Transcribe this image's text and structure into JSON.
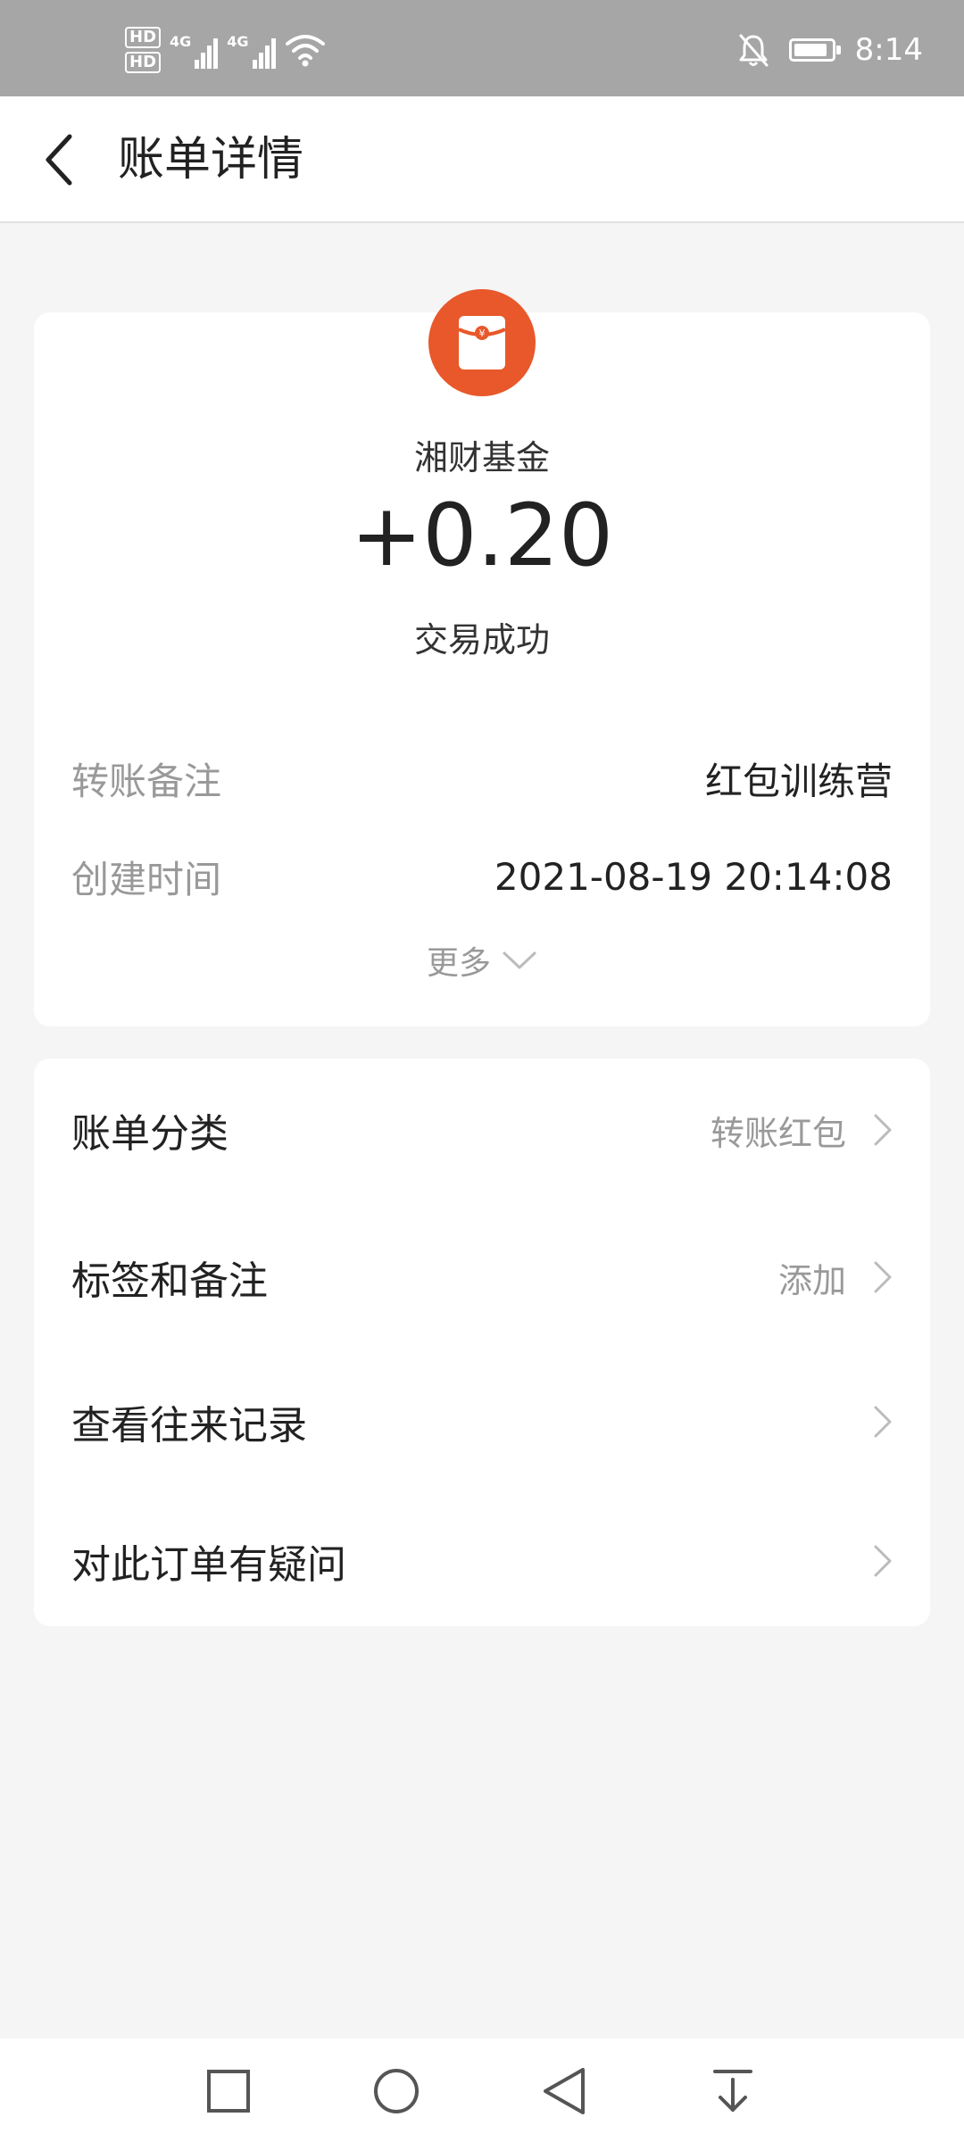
{
  "status_bar": {
    "time": "8:14",
    "sim1_label": "HD",
    "sim2_label": "HD",
    "net1": "4G",
    "net2": "4G"
  },
  "header": {
    "title": "账单详情"
  },
  "transaction": {
    "merchant": "湘财基金",
    "amount": "+0.20",
    "status": "交易成功",
    "icon": "red-envelope-icon",
    "icon_color": "#e8582a"
  },
  "details": [
    {
      "label": "转账备注",
      "value": "红包训练营"
    },
    {
      "label": "创建时间",
      "value": "2021-08-19 20:14:08"
    }
  ],
  "more_label": "更多",
  "actions": [
    {
      "label": "账单分类",
      "value": "转账红包"
    },
    {
      "label": "标签和备注",
      "value": "添加"
    },
    {
      "label": "查看往来记录",
      "value": ""
    },
    {
      "label": "对此订单有疑问",
      "value": ""
    }
  ],
  "nav": {
    "buttons": [
      "recent-apps-icon",
      "home-icon",
      "back-icon",
      "notification-pull-icon"
    ]
  }
}
